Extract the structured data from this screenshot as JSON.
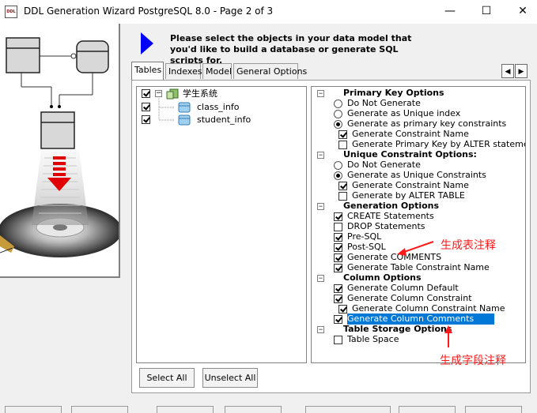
{
  "window": {
    "title": "DDL Generation Wizard PostgreSQL 8.0 - Page 2 of 3",
    "icon_text": "DDL",
    "minimize_glyph": "—",
    "maximize_glyph": "☐",
    "close_glyph": "✕"
  },
  "instruction": "Please select the objects in your data model that you'd like to build a database or generate SQL scripts for.",
  "tabs": [
    {
      "label": "Tables",
      "active": true
    },
    {
      "label": "Indexes",
      "active": false
    },
    {
      "label": "Model",
      "active": false
    },
    {
      "label": "General Options",
      "active": false
    }
  ],
  "nav": {
    "left_glyph": "◀",
    "right_glyph": "▶"
  },
  "tree": {
    "root": {
      "label": "学生系统",
      "checked": true,
      "expander": "−"
    },
    "children": [
      {
        "label": "class_info",
        "checked": true
      },
      {
        "label": "student_info",
        "checked": true
      }
    ]
  },
  "options": [
    {
      "type": "header",
      "label": "Primary Key Options"
    },
    {
      "type": "radio",
      "label": "Do Not Generate",
      "checked": false
    },
    {
      "type": "radio",
      "label": "Generate as Unique index",
      "checked": false
    },
    {
      "type": "radio",
      "label": "Generate as primary key constraints",
      "checked": true
    },
    {
      "type": "check",
      "label": "Generate Constraint Name",
      "checked": true,
      "sub": true
    },
    {
      "type": "check",
      "label": "Generate Primary Key by ALTER statement",
      "checked": false,
      "sub": true
    },
    {
      "type": "header",
      "label": "Unique Constraint Options:"
    },
    {
      "type": "radio",
      "label": "Do Not Generate",
      "checked": false
    },
    {
      "type": "radio",
      "label": "Generate as Unique Constraints",
      "checked": true
    },
    {
      "type": "check",
      "label": "Generate Constraint Name",
      "checked": true,
      "sub": true
    },
    {
      "type": "check",
      "label": "Generate by ALTER TABLE",
      "checked": false,
      "sub": true
    },
    {
      "type": "header",
      "label": "Generation Options"
    },
    {
      "type": "check",
      "label": "CREATE Statements",
      "checked": true
    },
    {
      "type": "check",
      "label": "DROP Statements",
      "checked": false
    },
    {
      "type": "check",
      "label": "Pre-SQL",
      "checked": true
    },
    {
      "type": "check",
      "label": "Post-SQL",
      "checked": true
    },
    {
      "type": "check",
      "label": "Generate COMMENTS",
      "checked": true
    },
    {
      "type": "check",
      "label": "Generate Table Constraint Name",
      "checked": true
    },
    {
      "type": "header",
      "label": "Column Options"
    },
    {
      "type": "check",
      "label": "Generate Column Default",
      "checked": true
    },
    {
      "type": "check",
      "label": "Generate Column Constraint",
      "checked": true
    },
    {
      "type": "check",
      "label": "Generate Column Constraint Name",
      "checked": true,
      "sub": true
    },
    {
      "type": "check",
      "label": "Generate Column Comments",
      "checked": true,
      "selected": true
    },
    {
      "type": "header",
      "label": "Table Storage Options"
    },
    {
      "type": "check",
      "label": "Table Space",
      "checked": false
    }
  ],
  "buttons": {
    "select_all": "Select All",
    "unselect_all": "Unselect All"
  },
  "annotations": {
    "table_comment": "生成表注释",
    "field_comment": "生成字段注释",
    "color": "#ff1a1a"
  },
  "colors": {
    "selection": "#0078d7",
    "arrow": "#0000ff"
  }
}
